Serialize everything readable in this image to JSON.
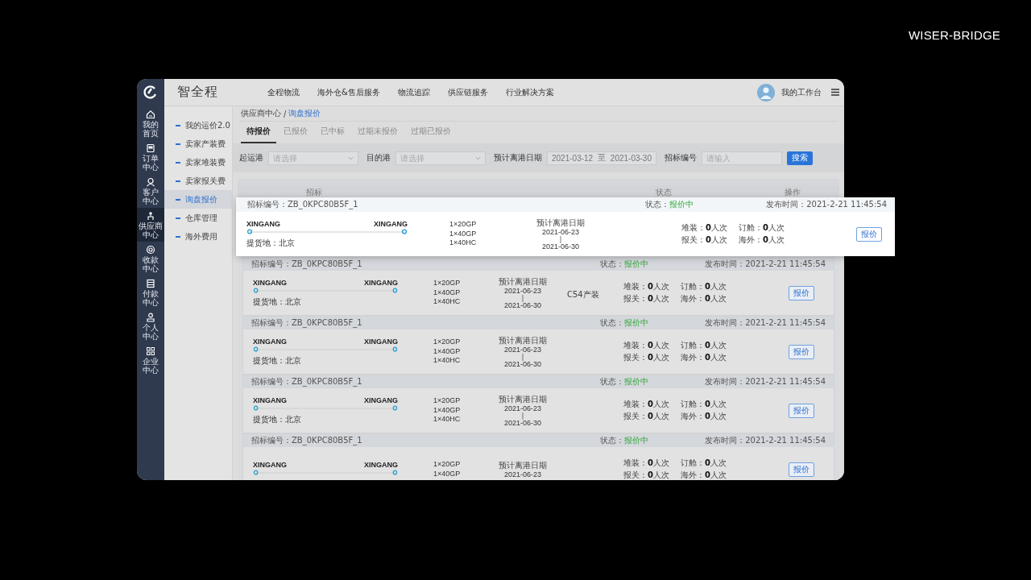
{
  "brand": "WISER-BRIDGE",
  "app": {
    "logo_text": "智全程"
  },
  "rail": {
    "items": [
      {
        "label": "我的首页",
        "selected": false
      },
      {
        "label": "订单中心",
        "selected": false
      },
      {
        "label": "客户中心",
        "selected": false
      },
      {
        "label": "供应商中心",
        "selected": true
      },
      {
        "label": "收款中心",
        "selected": false
      },
      {
        "label": "付款中心",
        "selected": false
      },
      {
        "label": "个人中心",
        "selected": false
      },
      {
        "label": "企业中心",
        "selected": false
      }
    ]
  },
  "nav": {
    "items": [
      "全程物流",
      "海外仓&售后服务",
      "物流追踪",
      "供应链服务",
      "行业解决方案"
    ]
  },
  "user": {
    "label": "我的工作台"
  },
  "sidebar": {
    "items": [
      {
        "label": "我的运价2.0",
        "selected": false
      },
      {
        "label": "卖家产装费",
        "selected": false
      },
      {
        "label": "卖家堆装费",
        "selected": false
      },
      {
        "label": "卖家报关费",
        "selected": false
      },
      {
        "label": "询盘报价",
        "selected": true
      },
      {
        "label": "仓库管理",
        "selected": false
      },
      {
        "label": "海外费用",
        "selected": false
      }
    ]
  },
  "breadcrumb": {
    "parent": "供应商中心",
    "sep": "/",
    "current": "询盘报价"
  },
  "tabs": [
    {
      "label": "待报价",
      "selected": true
    },
    {
      "label": "已报价",
      "selected": false
    },
    {
      "label": "已中标",
      "selected": false
    },
    {
      "label": "过期未报价",
      "selected": false
    },
    {
      "label": "过期已报价",
      "selected": false
    }
  ],
  "filters": {
    "origin": {
      "label": "起运港",
      "placeholder": "请选择"
    },
    "destination": {
      "label": "目的港",
      "placeholder": "请选择"
    },
    "date": {
      "label": "预计离港日期",
      "from": "2021-03-12",
      "sep": "至",
      "to": "2021-03-30"
    },
    "bid_no": {
      "label": "招标编号",
      "placeholder": "请输入"
    },
    "search_button": "搜索"
  },
  "table": {
    "columns": [
      "招标",
      "状态",
      "操作"
    ],
    "featured": {
      "bid_no": "招标编号：ZB_0KPC80B5F_1",
      "status_label": "状态：",
      "status": "报价中",
      "published": "发布时间：2021-2-21 11:45:54",
      "origin": "XINGANG",
      "destination": "XINGANG",
      "pickup": "提货地：北京",
      "containers": [
        "1×20GP",
        "1×40GP",
        "1×40HC"
      ],
      "date_label": "预计离港日期",
      "date_from": "2021-06-23",
      "date_sep": "|",
      "date_to": "2021-06-30",
      "stats": [
        "堆装：**0**人次",
        "订舱：**0**人次",
        "报关：**0**人次",
        "海外：**0**人次"
      ],
      "action": "报价"
    },
    "rows": [
      {
        "bid_no": "招标编号：ZB_0KPC80B5F_1",
        "status_label": "状态：",
        "status": "报价中",
        "published": "发布时间：2021-2-21 11:45:54",
        "origin": "XINGANG",
        "destination": "XINGANG",
        "pickup": "提货地：北京",
        "containers": [
          "1×20GP",
          "1×40GP",
          "1×40HC"
        ],
        "date_label": "预计离港日期",
        "date_from": "2021-06-23",
        "date_sep": "|",
        "date_to": "2021-06-30",
        "note": "C54产装",
        "stats": [
          "堆装：**0**人次",
          "订舱：**0**人次",
          "报关：**0**人次",
          "海外：**0**人次"
        ],
        "action": "报价"
      },
      {
        "bid_no": "招标编号：ZB_0KPC80B5F_1",
        "status_label": "状态：",
        "status": "报价中",
        "published": "发布时间：2021-2-21 11:45:54",
        "origin": "XINGANG",
        "destination": "XINGANG",
        "pickup": "提货地：北京",
        "containers": [
          "1×20GP",
          "1×40GP",
          "1×40HC"
        ],
        "date_label": "预计离港日期",
        "date_from": "2021-06-23",
        "date_sep": "|",
        "date_to": "2021-06-30",
        "stats": [
          "堆装：**0**人次",
          "订舱：**0**人次",
          "报关：**0**人次",
          "海外：**0**人次"
        ],
        "action": "报价"
      },
      {
        "bid_no": "招标编号：ZB_0KPC80B5F_1",
        "status_label": "状态：",
        "status": "报价中",
        "published": "发布时间：2021-2-21 11:45:54",
        "origin": "XINGANG",
        "destination": "XINGANG",
        "pickup": "提货地：北京",
        "containers": [
          "1×20GP",
          "1×40GP",
          "1×40HC"
        ],
        "date_label": "预计离港日期",
        "date_from": "2021-06-23",
        "date_sep": "|",
        "date_to": "2021-06-30",
        "stats": [
          "堆装：**0**人次",
          "订舱：**0**人次",
          "报关：**0**人次",
          "海外：**0**人次"
        ],
        "action": "报价"
      },
      {
        "bid_no": "招标编号：ZB_0KPC80B5F_1",
        "status_label": "状态：",
        "status": "报价中",
        "published": "发布时间：2021-2-21 11:45:54",
        "origin": "XINGANG",
        "destination": "XINGANG",
        "containers": [
          "1×20GP",
          "1×40GP"
        ],
        "date_label": "预计离港日期",
        "date_from": "2021-06-23",
        "stats": [
          "堆装：**0**人次",
          "订舱：**0**人次",
          "报关：**0**人次",
          "海外：**0**人次"
        ],
        "action": "报价"
      }
    ]
  }
}
